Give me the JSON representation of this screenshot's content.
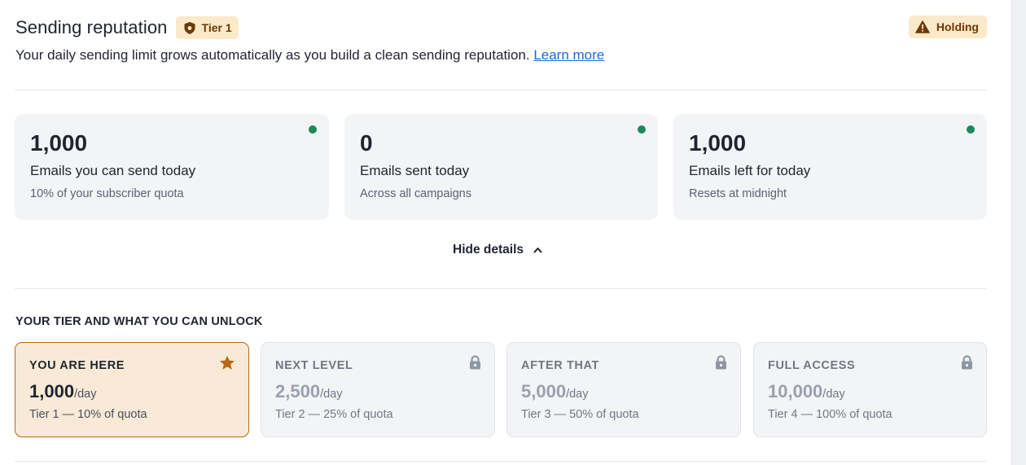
{
  "header": {
    "title": "Sending reputation",
    "tier_badge": "Tier 1",
    "status_badge": "Holding",
    "subtitle": "Your daily sending limit grows automatically as you build a clean sending reputation.",
    "learn_more": "Learn more"
  },
  "stats": [
    {
      "value": "1,000",
      "label": "Emails you can send today",
      "sub": "10% of your subscriber quota"
    },
    {
      "value": "0",
      "label": "Emails sent today",
      "sub": "Across all campaigns"
    },
    {
      "value": "1,000",
      "label": "Emails left for today",
      "sub": "Resets at midnight"
    }
  ],
  "toggle_label": "Hide details",
  "section_heading": "YOUR TIER AND WHAT YOU CAN UNLOCK",
  "tiers": [
    {
      "label": "YOU ARE HERE",
      "amount": "1,000",
      "per": "/day",
      "desc": "Tier 1 — 10% of quota",
      "icon": "star-icon"
    },
    {
      "label": "NEXT LEVEL",
      "amount": "2,500",
      "per": "/day",
      "desc": "Tier 2 — 25% of quota",
      "icon": "lock-icon"
    },
    {
      "label": "AFTER THAT",
      "amount": "5,000",
      "per": "/day",
      "desc": "Tier 3 — 50% of quota",
      "icon": "lock-icon"
    },
    {
      "label": "FULL ACCESS",
      "amount": "10,000",
      "per": "/day",
      "desc": "Tier 4 — 100% of quota",
      "icon": "lock-icon"
    }
  ],
  "colors": {
    "badge_bg": "#fbe9c9",
    "badge_text": "#6b3a06",
    "status_dot": "#1a8a5a",
    "current_tier_bg": "#f8ead6",
    "current_tier_border": "#b76a12",
    "link": "#1a6ad2"
  }
}
